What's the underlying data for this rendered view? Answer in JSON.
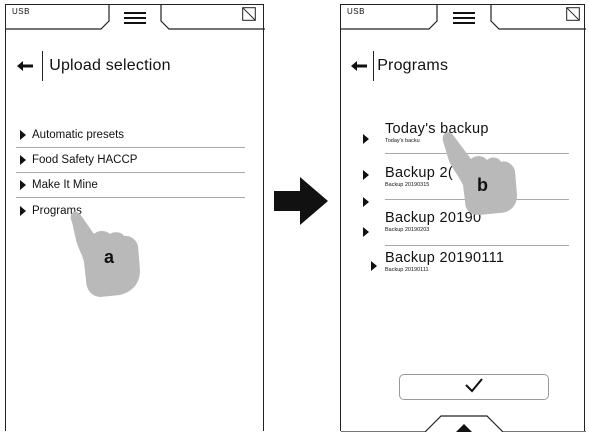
{
  "left_screen": {
    "status_label": "USB",
    "menu_icon": "hamburger-icon",
    "corner_icon": "crossed-box-icon",
    "back_icon": "left-arrow-icon",
    "title": "Upload selection",
    "items": [
      {
        "label": "Automatic presets"
      },
      {
        "label": "Food Safety HACCP"
      },
      {
        "label": "Make It Mine"
      },
      {
        "label": "Programs"
      }
    ],
    "callout": "a"
  },
  "transition_arrow_icon": "right-arrow-icon",
  "right_screen": {
    "status_label": "USB",
    "menu_icon": "hamburger-icon",
    "corner_icon": "crossed-box-icon",
    "back_icon": "left-arrow-icon",
    "title": "Programs",
    "programs": [
      {
        "name": "Today's backup",
        "sub": "Today's backu"
      },
      {
        "name": "Backup 2(",
        "sub": "Backup 20190315"
      },
      {
        "name": "Backup 20190",
        "sub": "Backup 20190203"
      },
      {
        "name": "Backup 20190111",
        "sub": "Backup 20190111"
      }
    ],
    "confirm_icon": "checkmark-icon",
    "bottom_icon": "up-triangle-icon",
    "callout": "b"
  }
}
